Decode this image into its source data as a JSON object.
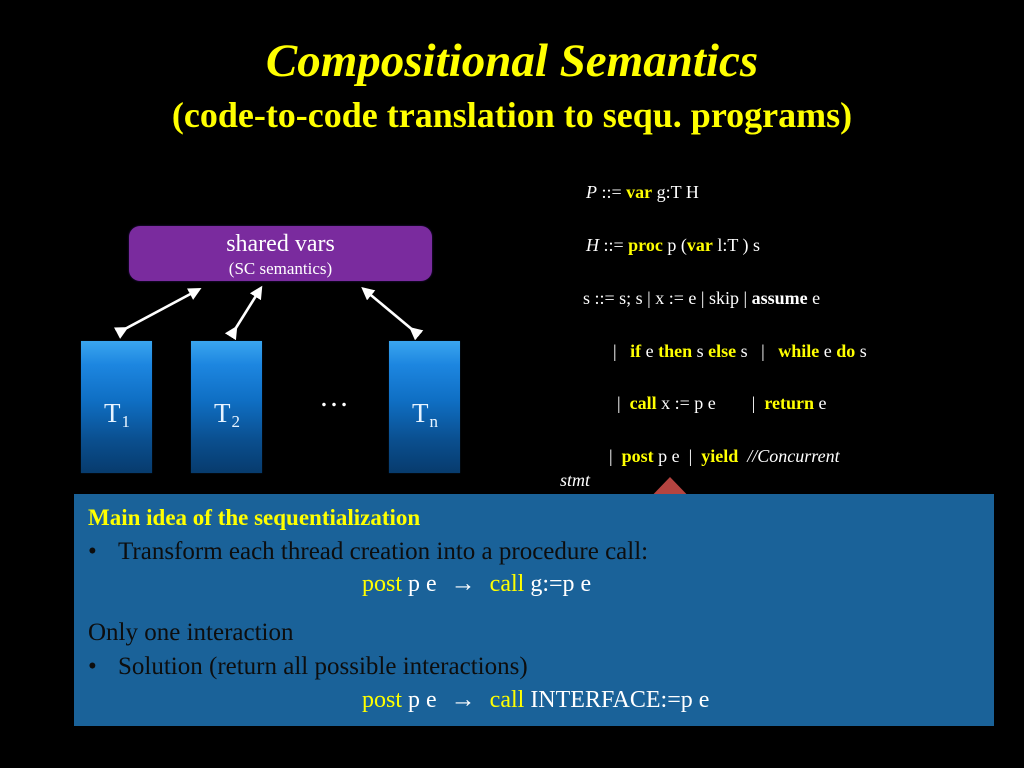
{
  "slide": {
    "title": "Compositional Semantics",
    "subtitle": "(code-to-code translation to sequ. programs)",
    "background_color": "#000000",
    "title_color": "#FFFF00"
  },
  "diagram": {
    "shared_box": {
      "title": "shared vars",
      "subtitle": "(SC semantics)",
      "color": "#7A2B9E"
    },
    "threads": [
      {
        "label": "T",
        "sub": "1"
      },
      {
        "label": "T",
        "sub": "2"
      },
      {
        "label": "T",
        "sub": "n"
      }
    ],
    "ellipsis": "…",
    "arrow_color": "#FFFFFF",
    "thread_color": "#1D86E0"
  },
  "grammar": {
    "line1": {
      "lhs": "P",
      "op": " ::= ",
      "kw": "var",
      "rest": " g:T H"
    },
    "line2": {
      "lhs": "H",
      "op": " ::= ",
      "kw": "proc",
      "mid": " p (",
      "kw2": "var",
      "rest": " l:T ) s"
    },
    "line3": {
      "lhs": "s ::= s; s  | x := e |   skip  |  ",
      "kw": "assume",
      "rest": " e"
    },
    "line4": {
      "bar": "|",
      "kw1": "if",
      "t1": " e ",
      "kw2": "then",
      "t2": " s ",
      "kw3": "else",
      "t3": " s",
      "bar2": "|",
      "kw4": "while",
      "t4": " e ",
      "kw5": "do",
      "t5": " s"
    },
    "line5": {
      "bar": "|",
      "kw1": "call",
      "t1": " x := p e",
      "bar2": "|",
      "kw2": "return",
      "t2": " e"
    },
    "line6": {
      "bar": "|",
      "kw1": "post",
      "t1": " p e",
      "bar2": "|",
      "kw2": "yield",
      "comment": "//Concurrent"
    },
    "line7": {
      "comment_cont": "stmt"
    },
    "keyword_color": "#FFFF00",
    "text_color": "#FFFFFF"
  },
  "red_arrow": {
    "name": "post-highlight-arrow",
    "color": "#B54440"
  },
  "main_panel": {
    "background_color": "#1A6299",
    "heading": "Main idea of the sequentialization",
    "bullet1": "Transform each thread creation into a procedure call:",
    "rule1": {
      "kw_left": "post",
      "left_rest": " p e",
      "arrow": "→",
      "kw_right": "call",
      "right_rest": " g:=p e"
    },
    "plain1": "Only one interaction",
    "bullet2": "Solution (return all possible interactions)",
    "rule2": {
      "kw_left": "post",
      "left_rest": " p e",
      "arrow": "→",
      "kw_right": "call",
      "right_rest": " INTERFACE:=p e"
    },
    "bullet_glyph": "•",
    "heading_color": "#FFFF00",
    "body_color": "#0D0D0D"
  }
}
